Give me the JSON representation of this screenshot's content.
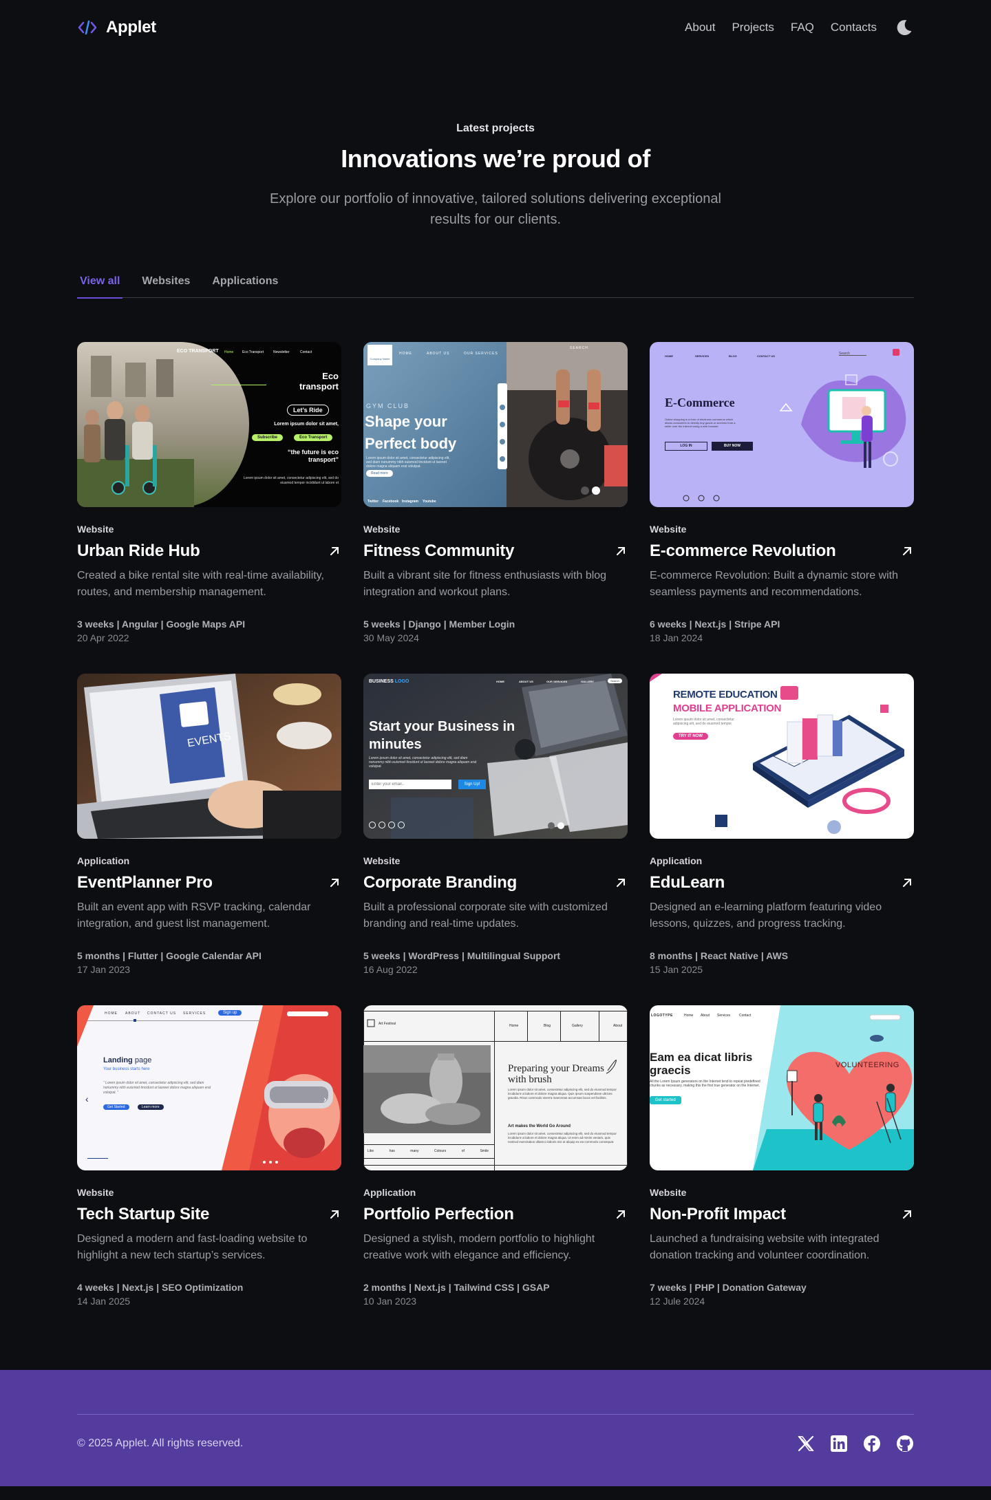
{
  "nav": {
    "brand": "Applet",
    "links": [
      "About",
      "Projects",
      "FAQ",
      "Contacts"
    ]
  },
  "hero": {
    "eyebrow": "Latest projects",
    "title": "Innovations we’re proud of",
    "subtitle": "Explore our portfolio of innovative, tailored solutions delivering exceptional results for our clients."
  },
  "tabs": [
    {
      "label": "View all",
      "active": true
    },
    {
      "label": "Websites",
      "active": false
    },
    {
      "label": "Applications",
      "active": false
    }
  ],
  "projects": [
    {
      "category": "Website",
      "title": "Urban Ride Hub",
      "desc": "Created a bike rental site with real-time availability, routes, and membership management.",
      "meta": "3 weeks | Angular | Google Maps API",
      "date": "20 Apr 2022"
    },
    {
      "category": "Website",
      "title": "Fitness Community",
      "desc": "Built a vibrant site for fitness enthusiasts with blog integration and workout plans.",
      "meta": "5 weeks | Django | Member Login",
      "date": "30 May 2024"
    },
    {
      "category": "Website",
      "title": "E-commerce Revolution",
      "desc": "E-commerce Revolution: Built a dynamic store with seamless payments and recommendations.",
      "meta": "6 weeks | Next.js | Stripe API",
      "date": "18 Jan 2024"
    },
    {
      "category": "Application",
      "title": "EventPlanner Pro",
      "desc": "Built an event app with RSVP tracking, calendar integration, and guest list management.",
      "meta": "5 months | Flutter | Google Calendar API",
      "date": "17 Jan 2023"
    },
    {
      "category": "Website",
      "title": "Corporate Branding",
      "desc": "Built a professional corporate site with customized branding and real-time updates.",
      "meta": "5 weeks | WordPress | Multilingual Support",
      "date": "16 Aug 2022"
    },
    {
      "category": "Application",
      "title": "EduLearn",
      "desc": "Designed an e-learning platform featuring video lessons, quizzes, and progress tracking.",
      "meta": "8 months | React Native | AWS",
      "date": "15 Jan 2025"
    },
    {
      "category": "Website",
      "title": "Tech Startup Site",
      "desc": "Designed a modern and fast-loading website to highlight a new tech startup’s services.",
      "meta": "4 weeks | Next.js | SEO Optimization",
      "date": "14 Jan 2025"
    },
    {
      "category": "Application",
      "title": "Portfolio Perfection",
      "desc": "Designed a stylish, modern portfolio to highlight creative work with elegance and efficiency.",
      "meta": "2 months | Next.js | Tailwind CSS | GSAP",
      "date": "10 Jan 2023"
    },
    {
      "category": "Website",
      "title": "Non-Profit Impact",
      "desc": "Launched a fundraising website with integrated donation tracking and volunteer coordination.",
      "meta": "7 weeks | PHP | Donation Gateway",
      "date": "12 Jule 2024"
    }
  ],
  "thumbs": {
    "urban": {
      "logo": "ECO TRANSPORT",
      "nav": [
        "Home",
        "Eco Transport",
        "Newsletter",
        "Contact"
      ],
      "headline": "Eco transport",
      "badge": "Let’s Ride",
      "lorem": "Lorem ipsum dolor sit amet,",
      "btn1": "Subscribe",
      "btn2": "Eco Transport",
      "quote": "“the future is eco transport”",
      "small": "Lorem ipsum dolor sit amet, consectetur adipiscing elit, sed do eiusmod tempor incididunt ut labore et"
    },
    "fitness": {
      "logo": "Company Name",
      "nav": [
        "HOME",
        "ABOUT US",
        "OUR SERVICES"
      ],
      "kicker": "GYM CLUB",
      "headline": "Shape your Perfect body",
      "body": "Lorem ipsum dolor sit amet, consectetur adipiscing elit, sed diam nonummy nibh euismod tincidunt ut laoreet dolore magna aliquam erat volutpat.",
      "cta": "Read more",
      "social": [
        "Twitter",
        "Facebook",
        "Instagram",
        "Youtube"
      ],
      "search": "SEARCH"
    },
    "ecom": {
      "nav": [
        "HOME",
        "SERVICES",
        "BLOG",
        "CONTACT US"
      ],
      "search": "Search",
      "headline": "E-Commerce",
      "body": "Online shopping is a form of electronic commerce which allows consumers to directly buy goods or services from a seller over the Internet using a web browser.",
      "login": "LOG IN",
      "buy": "BUY NOW"
    },
    "corp": {
      "logo1": "BUSINESS",
      "logo2": "LOGO",
      "nav": [
        "HOME",
        "ABOUT US",
        "OUR SERVICES",
        "GALLERY"
      ],
      "search": "Search",
      "headline": "Start your Business in minutes",
      "body": "Lorem ipsum dolor sit amet, consectetur adipiscing elit, sed diam nonummy nibh euismod tincidunt ut laoreet dolore magna aliquam erat volutpat.",
      "placeholder": "Enter your email..",
      "cta": "Sign Up!"
    },
    "events": {
      "label": "EVENTS"
    },
    "edu": {
      "line1": "REMOTE EDUCATION",
      "line2": "MOBILE APPLICATION",
      "body": "Lorem ipsum dolor sit amet, consectetur adipiscing elit, sed do eiusmod tempor",
      "cta": "TRY IT NOW"
    },
    "tech": {
      "nav": [
        "HOME",
        "ABOUT",
        "CONTACT US",
        "SERVICES"
      ],
      "cta": "Sign up",
      "title": "Landing",
      "title2": "page",
      "sub": "Your business starts here",
      "quote": "“ Lorem ipsum dolor sit amet, consectetur adipiscing elit, sed diam nonummy nibh euismod tincidunt ut laoreet dolore magna aliquam erat volutpat. ”",
      "b1": "Get Started",
      "b2": "Learn more"
    },
    "port": {
      "brand": "Art Festival",
      "nav": [
        "Home",
        "Blog",
        "Gallery",
        "About"
      ],
      "headline": "Preparing your Dreams with brush",
      "body": "Lorem ipsum dolor sit amet, consectetur adipiscing elit, sed do eiusmod tempor incididunt ut labore et dolore magna aliqua. Quis ipsum suspendisse ultrices gravida. Risus commodo viverra maecenas accumsan lacus vel facilisis.",
      "sub": "Art makes the World Go Around",
      "body2": "Lorem ipsum dolor sit amet, consectetur adipiscing elit, sed do eiusmod tempor incididunt ut labore et dolore magna aliqua. Ut enim ad minim veniam, quis nostrud exercitation ullamco laboris nisi ut aliquip ex ea commodo consequat.",
      "foot": [
        "Like",
        "has",
        "many",
        "Colours",
        "of",
        "Smile"
      ]
    },
    "np": {
      "logo": "LOGOTYPE",
      "nav": [
        "Home",
        "About",
        "Services",
        "Contact"
      ],
      "headline": "Eam ea dicat libris graecis",
      "body": "All the Lorem Ipsum generators on the Internet tend to repeat predefined chunks as necessary, making this the first true generator on the Internet.",
      "cta": "Get started",
      "heart": "VOLUNTEERING"
    }
  },
  "footer": {
    "copy": "© 2025 Applet. All rights reserved."
  },
  "colors": {
    "bg": "#0d0e12",
    "accent": "#7a63e9",
    "footer": "#533c9e"
  }
}
